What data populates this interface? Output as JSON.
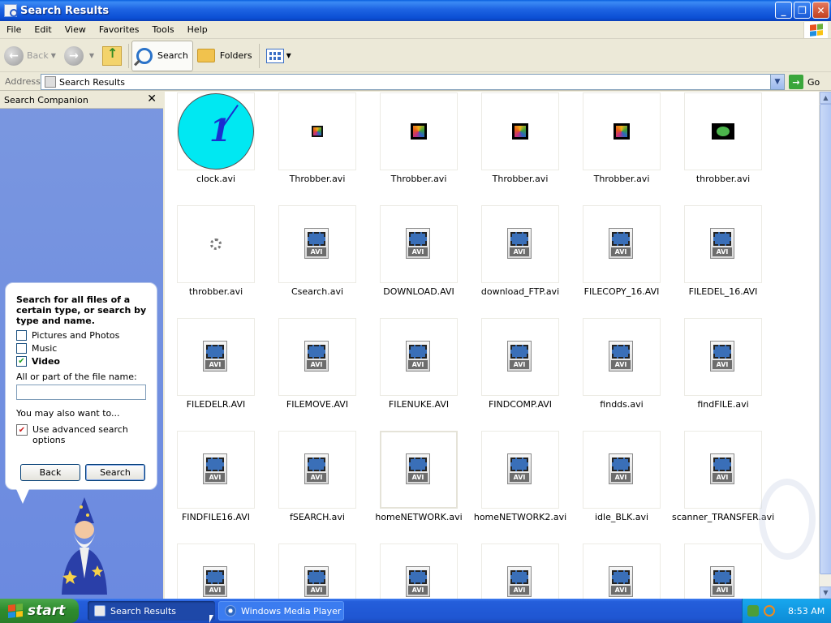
{
  "window": {
    "title": "Search Results",
    "controls": [
      "minimize",
      "maximize",
      "close"
    ]
  },
  "menubar": {
    "items": [
      "File",
      "Edit",
      "View",
      "Favorites",
      "Tools",
      "Help"
    ]
  },
  "toolbar": {
    "back_label": "Back",
    "forward_label": "",
    "search_label": "Search",
    "folders_label": "Folders"
  },
  "address": {
    "label": "Address",
    "value": "Search Results",
    "go_label": "Go"
  },
  "search_companion": {
    "title": "Search Companion",
    "close_glyph": "✕",
    "heading": "Search for all files of a certain type, or search by type and name.",
    "options": [
      {
        "label": "Pictures and Photos",
        "checked": false
      },
      {
        "label": "Music",
        "checked": false
      },
      {
        "label": "Video",
        "checked": true
      }
    ],
    "filename_label": "All or part of the file name:",
    "filename_value": "",
    "also_want": "You may also want to...",
    "advanced_label": "Use advanced search options",
    "back_button": "Back",
    "search_button": "Search"
  },
  "files": [
    {
      "name": "clock.avi",
      "thumb": "clock"
    },
    {
      "name": "Throbber.avi",
      "thumb": "throbber-small"
    },
    {
      "name": "Throbber.avi",
      "thumb": "throbber-big"
    },
    {
      "name": "Throbber.avi",
      "thumb": "throbber-big"
    },
    {
      "name": "Throbber.avi",
      "thumb": "throbber-big"
    },
    {
      "name": "throbber.avi",
      "thumb": "throbber-green"
    },
    {
      "name": "throbber.avi",
      "thumb": "spinner"
    },
    {
      "name": "Csearch.avi",
      "thumb": "avi-icon"
    },
    {
      "name": "DOWNLOAD.AVI",
      "thumb": "avi-icon"
    },
    {
      "name": "download_FTP.avi",
      "thumb": "avi-icon"
    },
    {
      "name": "FILECOPY_16.AVI",
      "thumb": "avi-icon"
    },
    {
      "name": "FILEDEL_16.AVI",
      "thumb": "avi-icon"
    },
    {
      "name": "FILEDELR.AVI",
      "thumb": "avi-icon"
    },
    {
      "name": "FILEMOVE.AVI",
      "thumb": "avi-icon"
    },
    {
      "name": "FILENUKE.AVI",
      "thumb": "avi-icon"
    },
    {
      "name": "FINDCOMP.AVI",
      "thumb": "avi-icon"
    },
    {
      "name": "findds.avi",
      "thumb": "avi-icon"
    },
    {
      "name": "findFILE.avi",
      "thumb": "avi-icon"
    },
    {
      "name": "FINDFILE16.AVI",
      "thumb": "avi-icon"
    },
    {
      "name": "fSEARCH.avi",
      "thumb": "avi-icon"
    },
    {
      "name": "homeNETWORK.avi",
      "thumb": "avi-icon",
      "hover": true
    },
    {
      "name": "homeNETWORK2.avi",
      "thumb": "avi-icon"
    },
    {
      "name": "idle_BLK.avi",
      "thumb": "avi-icon"
    },
    {
      "name": "scanner_TRANSFER.avi",
      "thumb": "avi-icon"
    },
    {
      "name": "",
      "thumb": "avi-icon"
    },
    {
      "name": "",
      "thumb": "avi-icon"
    },
    {
      "name": "",
      "thumb": "avi-icon"
    },
    {
      "name": "",
      "thumb": "avi-icon"
    },
    {
      "name": "",
      "thumb": "avi-icon"
    },
    {
      "name": "",
      "thumb": "avi-icon"
    }
  ],
  "avi_tag": "AVI",
  "taskbar": {
    "start_label": "start",
    "tasks": [
      {
        "label": "Search Results",
        "active": true
      },
      {
        "label": "Windows Media Player",
        "active": false
      }
    ],
    "clock": "8:53 AM"
  },
  "colors": {
    "titlebar": "#0b4fd4",
    "pane_bg": "#6b8ae0",
    "start_green": "#2e8c2e",
    "tray_blue": "#0d8bd6"
  }
}
